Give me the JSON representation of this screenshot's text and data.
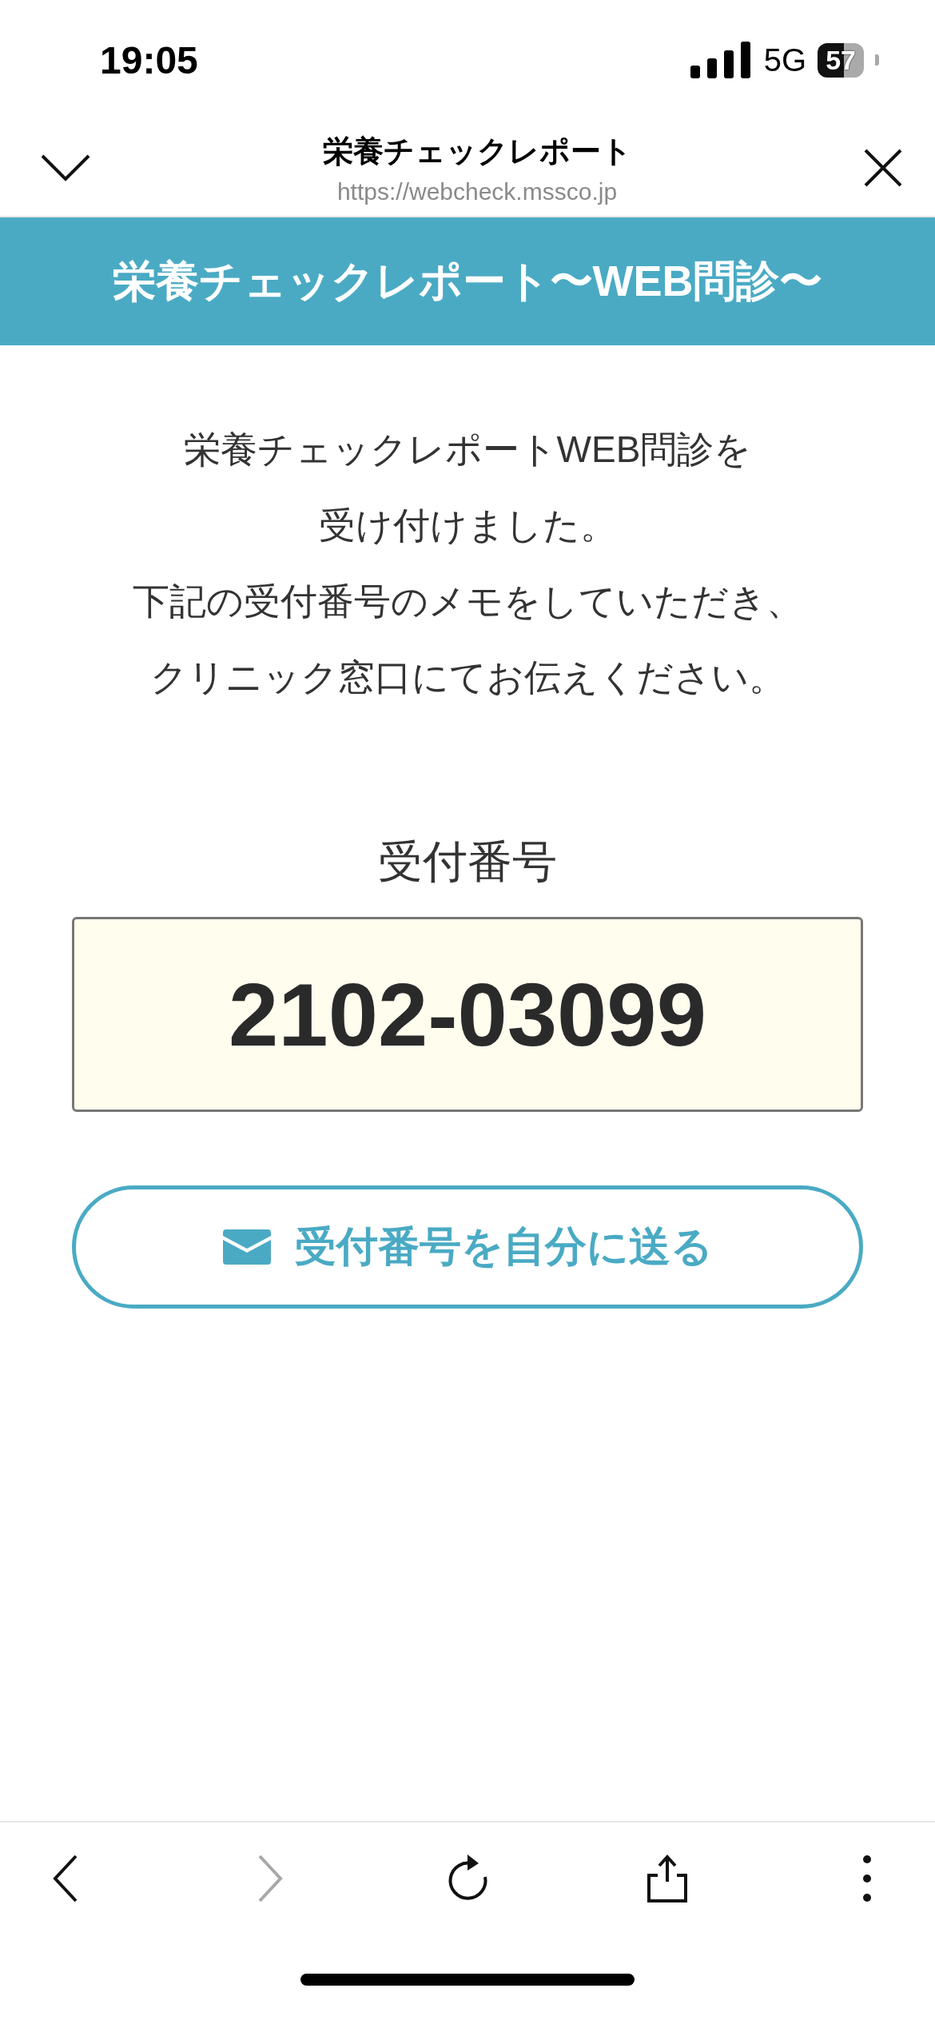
{
  "status_bar": {
    "time": "19:05",
    "network": "5G",
    "battery": "57"
  },
  "browser_header": {
    "title": "栄養チェックレポート",
    "url": "https://webcheck.mssco.jp"
  },
  "banner": {
    "title": "栄養チェックレポート〜WEB問診〜"
  },
  "message_lines": [
    "栄養チェックレポートWEB問診を",
    "受け付けました。",
    "下記の受付番号のメモをしていただき、",
    "クリニック窓口にてお伝えください。"
  ],
  "reception": {
    "label": "受付番号",
    "number": "2102-03099"
  },
  "send_button": {
    "label": "受付番号を自分に送る"
  },
  "toolbar": [
    {
      "kind": "back",
      "disabled": false
    },
    {
      "kind": "forward",
      "disabled": true
    },
    {
      "kind": "reload",
      "disabled": false
    },
    {
      "kind": "share",
      "disabled": false
    },
    {
      "kind": "more",
      "disabled": false
    }
  ]
}
